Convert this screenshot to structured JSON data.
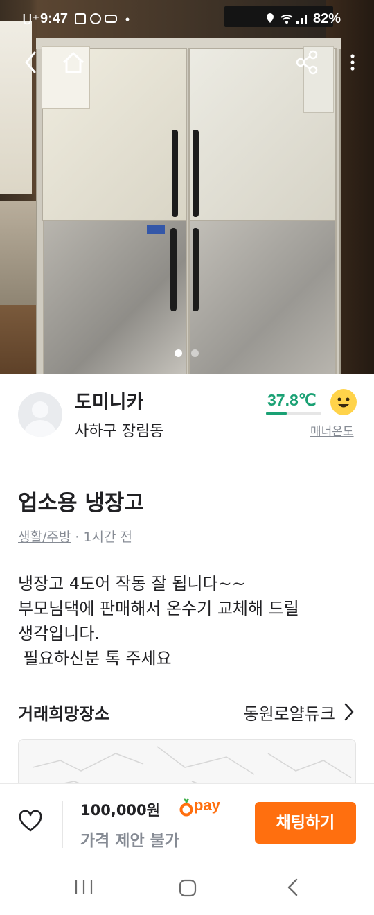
{
  "status_bar": {
    "carrier": "U⁺",
    "time": "9:47",
    "battery": "82%"
  },
  "photo_pager": {
    "count": 2,
    "current": 1
  },
  "seller": {
    "name": "도미니카",
    "location": "사하구 장림동",
    "temperature": "37.8℃",
    "temperature_value": 37.8,
    "manner_label": "매너온도"
  },
  "article": {
    "title": "업소용 냉장고",
    "category": "생활/주방",
    "time_ago": " · 1시간 전",
    "description": "냉장고 4도어 작동 잘 됩니다~~\n부모님댁에 판매해서 온수기 교체해 드릴\n생각입니다.\n 필요하신분 톡 주세요"
  },
  "trade_place": {
    "label": "거래희망장소",
    "value": "동원로얄듀크"
  },
  "bottom_bar": {
    "price": "100,000원",
    "pay_label": "pay",
    "negotiation": "가격 제안 불가",
    "chat_button": "채팅하기"
  },
  "colors": {
    "accent": "#ff6f0f",
    "temperature": "#1aa174",
    "muted": "#868b94",
    "text": "#212124"
  },
  "icons": [
    "back-icon",
    "home-icon",
    "share-icon",
    "more-icon",
    "face-icon",
    "chevron-right-icon",
    "heart-icon",
    "carrot-icon",
    "nav-recents-icon",
    "nav-home-icon",
    "nav-back-icon"
  ]
}
